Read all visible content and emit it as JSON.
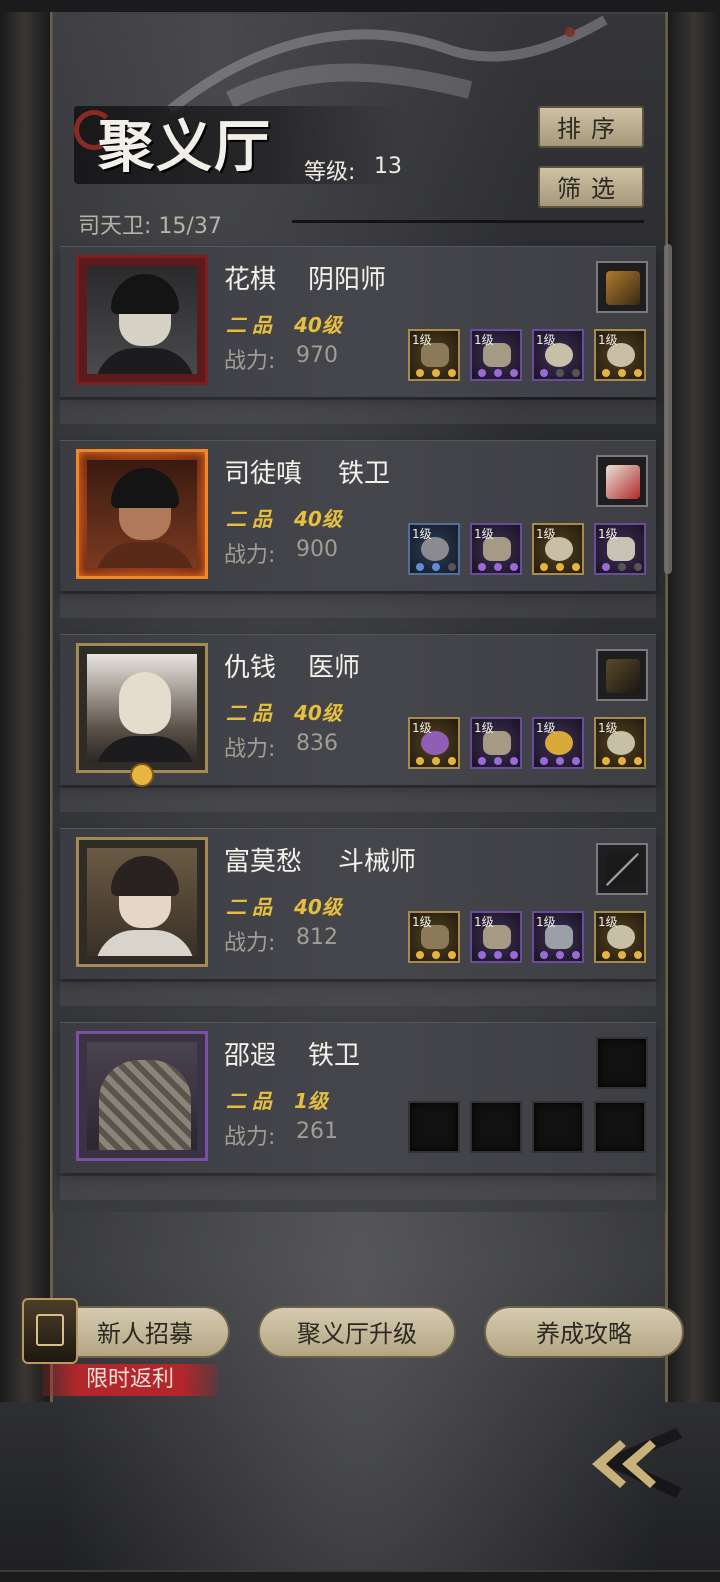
{
  "header": {
    "title": "聚义厅",
    "level_label": "等级:",
    "level_value": "13",
    "guards_label": "司天卫:",
    "guards_value": "15/37",
    "sort_button": "排序",
    "filter_button": "筛选"
  },
  "heroes": [
    {
      "name": "花棋",
      "class": "阴阳师",
      "rank": "二品",
      "level": "40级",
      "power_label": "战力:",
      "power": "970",
      "equipment": [
        {
          "level": "1级",
          "icon": "staff-icon"
        },
        {
          "level": "1级",
          "icon": "armor-icon"
        },
        {
          "level": "1级",
          "icon": "orb-icon"
        },
        {
          "level": "1级",
          "icon": "pouch-icon"
        }
      ]
    },
    {
      "name": "司徒嗔",
      "class": "铁卫",
      "rank": "二品",
      "level": "40级",
      "power_label": "战力:",
      "power": "900",
      "equipment": [
        {
          "level": "1级",
          "icon": "mace-icon"
        },
        {
          "level": "1级",
          "icon": "armor-icon"
        },
        {
          "level": "1级",
          "icon": "pouch-icon"
        },
        {
          "level": "1级",
          "icon": "claw-icon"
        }
      ]
    },
    {
      "name": "仇钱",
      "class": "医师",
      "rank": "二品",
      "level": "40级",
      "power_label": "战力:",
      "power": "836",
      "equipment": [
        {
          "level": "1级",
          "icon": "gourd-icon"
        },
        {
          "level": "1级",
          "icon": "armor-icon"
        },
        {
          "level": "1级",
          "icon": "coin-icon"
        },
        {
          "level": "1级",
          "icon": "pouch-icon"
        }
      ]
    },
    {
      "name": "富莫愁",
      "class": "斗械师",
      "rank": "二品",
      "level": "40级",
      "power_label": "战力:",
      "power": "812",
      "equipment": [
        {
          "level": "1级",
          "icon": "crossbow-icon"
        },
        {
          "level": "1级",
          "icon": "armor-icon"
        },
        {
          "level": "1级",
          "icon": "bracer-icon"
        },
        {
          "level": "1级",
          "icon": "pouch-icon"
        }
      ]
    },
    {
      "name": "邵遐",
      "class": "铁卫",
      "rank": "二品",
      "level": "1级",
      "power_label": "战力:",
      "power": "261",
      "equipment": []
    }
  ],
  "footer": {
    "recruit_button": "新人招募",
    "promo_tag": "限时返利",
    "upgrade_button": "聚义厅升级",
    "guide_button": "养成攻略"
  }
}
